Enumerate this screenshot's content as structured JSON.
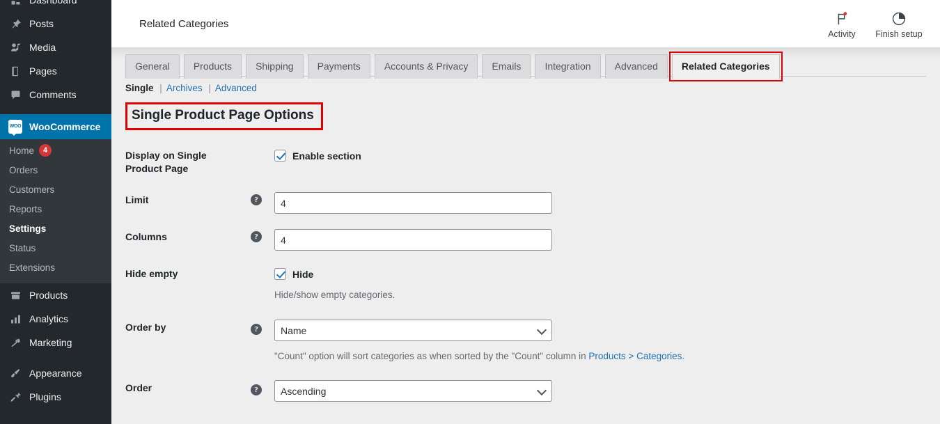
{
  "sidebar": {
    "items": [
      {
        "label": "Dashboard",
        "icon": "dashboard-icon"
      },
      {
        "label": "Posts",
        "icon": "pin-icon"
      },
      {
        "label": "Media",
        "icon": "media-icon"
      },
      {
        "label": "Pages",
        "icon": "pages-icon"
      },
      {
        "label": "Comments",
        "icon": "comment-icon"
      },
      {
        "label": "WooCommerce",
        "icon": "woo-icon"
      }
    ],
    "woo_badge_text": "WOO",
    "submenu": [
      {
        "label": "Home",
        "count": "4"
      },
      {
        "label": "Orders",
        "count": ""
      },
      {
        "label": "Customers",
        "count": ""
      },
      {
        "label": "Reports",
        "count": ""
      },
      {
        "label": "Settings",
        "count": ""
      },
      {
        "label": "Status",
        "count": ""
      },
      {
        "label": "Extensions",
        "count": ""
      }
    ],
    "items_lower": [
      {
        "label": "Products",
        "icon": "products-icon"
      },
      {
        "label": "Analytics",
        "icon": "analytics-icon"
      },
      {
        "label": "Marketing",
        "icon": "megaphone-icon"
      }
    ],
    "items_lower2": [
      {
        "label": "Appearance",
        "icon": "brush-icon"
      },
      {
        "label": "Plugins",
        "icon": "plug-icon"
      }
    ],
    "active_item": "WooCommerce",
    "active_subitem": "Settings",
    "accent_color": "#0073aa",
    "badge_color": "#d63638"
  },
  "header": {
    "title": "Related Categories",
    "actions": [
      {
        "label": "Activity",
        "icon": "flag-icon"
      },
      {
        "label": "Finish setup",
        "icon": "progress-circle-icon"
      }
    ]
  },
  "tabs": [
    {
      "label": "General",
      "active": false
    },
    {
      "label": "Products",
      "active": false
    },
    {
      "label": "Shipping",
      "active": false
    },
    {
      "label": "Payments",
      "active": false
    },
    {
      "label": "Accounts & Privacy",
      "active": false
    },
    {
      "label": "Emails",
      "active": false
    },
    {
      "label": "Integration",
      "active": false
    },
    {
      "label": "Advanced",
      "active": false
    },
    {
      "label": "Related Categories",
      "active": true
    }
  ],
  "subnav": {
    "current": "Single",
    "sep": "|",
    "links": [
      "Archives",
      "Advanced"
    ]
  },
  "section": {
    "title": "Single Product Page Options",
    "highlight_color": "#e00000"
  },
  "form": {
    "rows": [
      {
        "label": "Display on Single Product Page",
        "type": "checkbox",
        "checkbox_label": "Enable section",
        "checked": true,
        "has_tip": false,
        "desc": ""
      },
      {
        "label": "Limit",
        "type": "text",
        "value": "4",
        "has_tip": true,
        "desc": ""
      },
      {
        "label": "Columns",
        "type": "text",
        "value": "4",
        "has_tip": true,
        "desc": ""
      },
      {
        "label": "Hide empty",
        "type": "checkbox",
        "checkbox_label": "Hide",
        "checked": true,
        "has_tip": false,
        "desc": "Hide/show empty categories."
      },
      {
        "label": "Order by",
        "type": "select",
        "value": "Name",
        "has_tip": true,
        "desc_prefix": "\"Count\" option will sort categories as when sorted by the \"Count\" column in ",
        "desc_link": "Products > Categories",
        "desc_suffix": "."
      },
      {
        "label": "Order",
        "type": "select",
        "value": "Ascending",
        "has_tip": true,
        "desc": ""
      }
    ],
    "help_tip_glyph": "?"
  }
}
